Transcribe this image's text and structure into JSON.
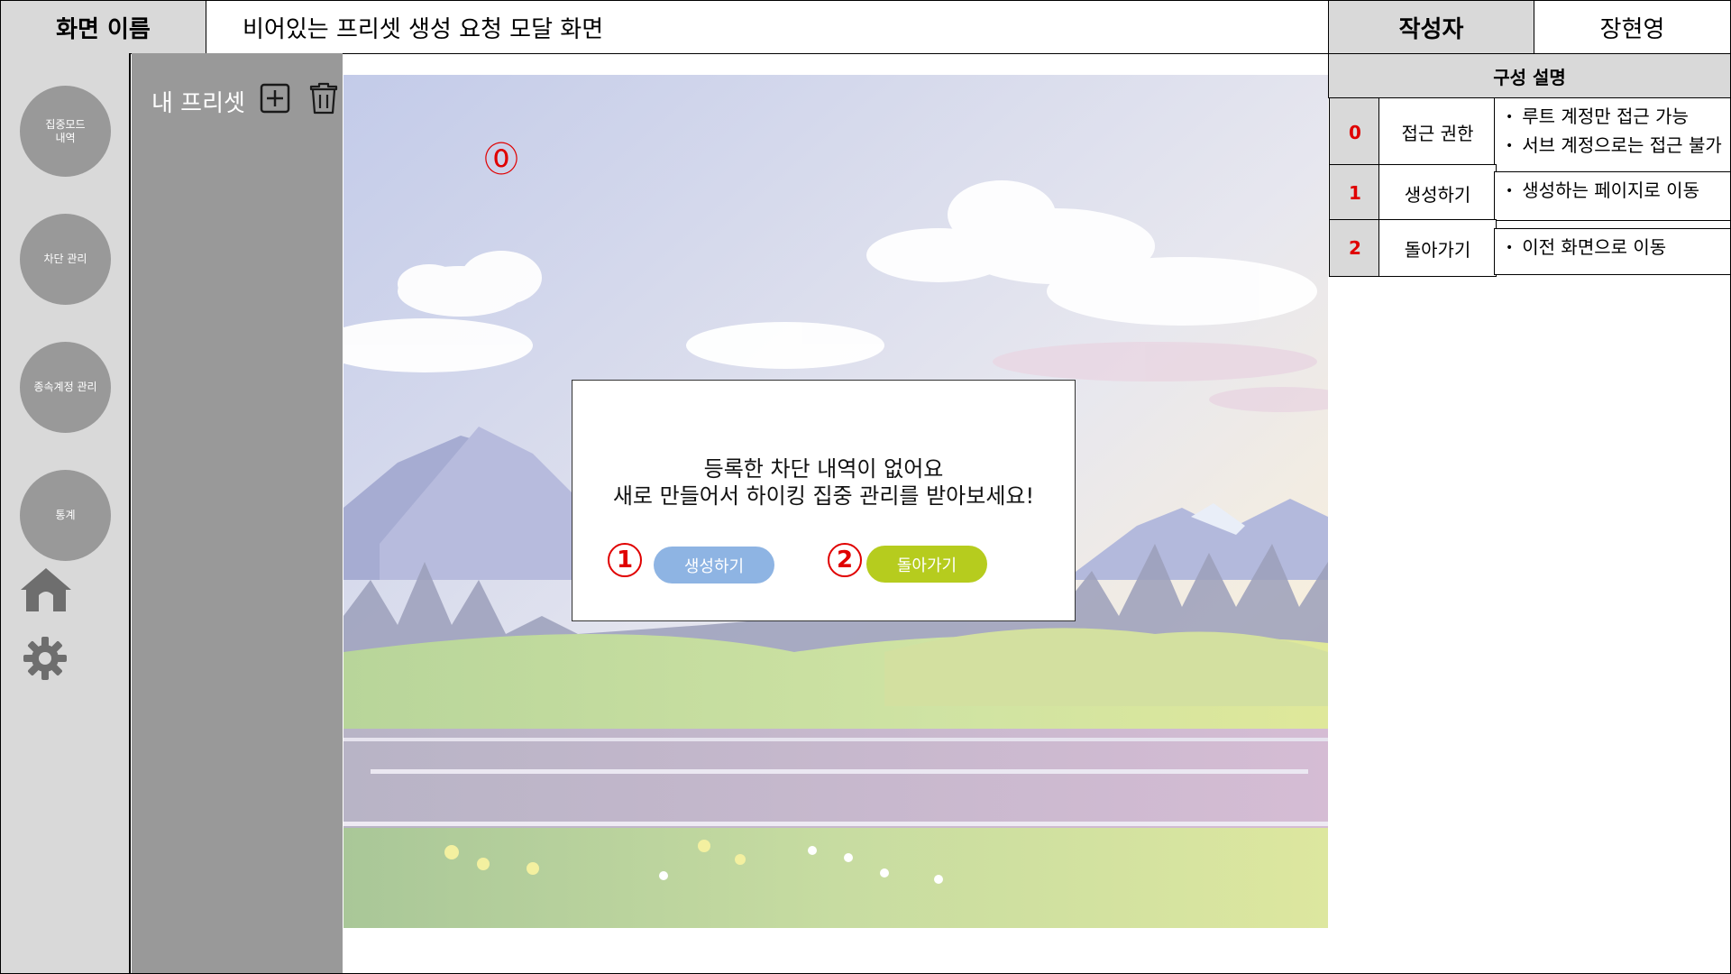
{
  "header": {
    "screen_name_label": "화면 이름",
    "screen_name": "비어있는 프리셋 생성 요청 모달 화면",
    "author_label": "작성자",
    "author_name": "장현영"
  },
  "nav": {
    "items": [
      {
        "label": "집중모드\n내역"
      },
      {
        "label": "차단 관리"
      },
      {
        "label": "종속계정 관리"
      },
      {
        "label": "통계"
      }
    ],
    "home_icon": "home-icon",
    "settings_icon": "gear-icon"
  },
  "preset_panel": {
    "title": "내 프리셋",
    "add_icon": "plus-square-icon",
    "delete_icon": "trash-icon"
  },
  "canvas": {
    "marker": "⓪"
  },
  "modal": {
    "line1": "등록한 차단 내역이 없어요",
    "line2": "새로 만들어서 하이킹 집중 관리를 받아보세요!",
    "create_button": "생성하기",
    "back_button": "돌아가기",
    "marker1": "1",
    "marker2": "2",
    "create_color": "#8eb4e3",
    "back_color": "#b6cc1e"
  },
  "description": {
    "title": "구성 설명",
    "rows": [
      {
        "num": "0",
        "label": "접근 권한",
        "items": [
          "루트 계정만 접근 가능",
          "서브 계정으로는 접근 불가"
        ]
      },
      {
        "num": "1",
        "label": "생성하기",
        "items": [
          "생성하는 페이지로 이동"
        ]
      },
      {
        "num": "2",
        "label": "돌아가기",
        "items": [
          "이전 화면으로 이동"
        ]
      }
    ]
  }
}
